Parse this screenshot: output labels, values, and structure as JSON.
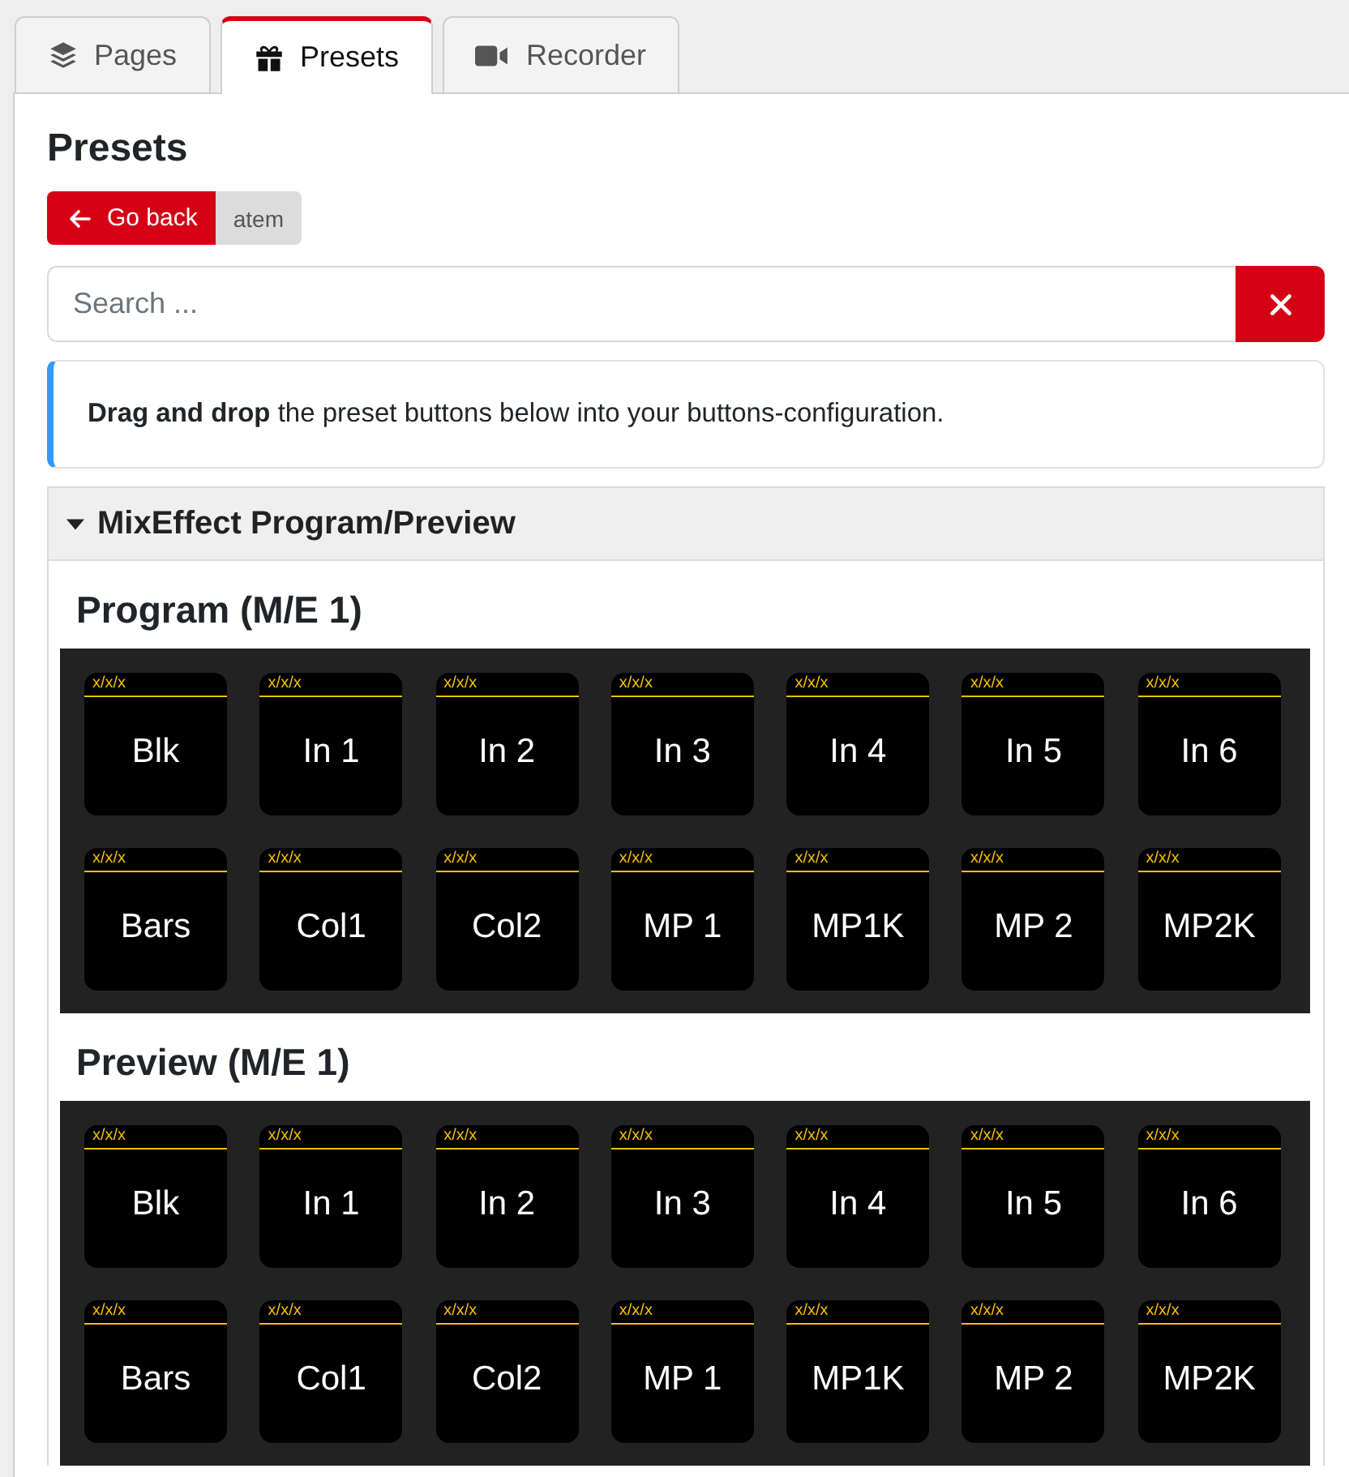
{
  "tabs": [
    {
      "label": "Pages",
      "selected": false
    },
    {
      "label": "Presets",
      "selected": true
    },
    {
      "label": "Recorder",
      "selected": false
    }
  ],
  "page_title": "Presets",
  "breadcrumb": {
    "back_button": "Go back",
    "module": "atem"
  },
  "search": {
    "placeholder": "Search ..."
  },
  "info": "**Drag and drop** the preset buttons below into your buttons-configuration.",
  "accordion": {
    "title": "MixEffect Program/Preview",
    "expanded": true,
    "groups": [
      {
        "heading": "Program (M/E 1)",
        "buttons": [
          {
            "location": "x/x/x",
            "label": "Blk"
          },
          {
            "location": "x/x/x",
            "label": "In 1"
          },
          {
            "location": "x/x/x",
            "label": "In 2"
          },
          {
            "location": "x/x/x",
            "label": "In 3"
          },
          {
            "location": "x/x/x",
            "label": "In 4"
          },
          {
            "location": "x/x/x",
            "label": "In 5"
          },
          {
            "location": "x/x/x",
            "label": "In 6"
          },
          {
            "location": "x/x/x",
            "label": "Bars"
          },
          {
            "location": "x/x/x",
            "label": "Col1"
          },
          {
            "location": "x/x/x",
            "label": "Col2"
          },
          {
            "location": "x/x/x",
            "label": "MP 1"
          },
          {
            "location": "x/x/x",
            "label": "MP1K"
          },
          {
            "location": "x/x/x",
            "label": "MP 2"
          },
          {
            "location": "x/x/x",
            "label": "MP2K"
          }
        ]
      },
      {
        "heading": "Preview (M/E 1)",
        "buttons": [
          {
            "location": "x/x/x",
            "label": "Blk"
          },
          {
            "location": "x/x/x",
            "label": "In 1"
          },
          {
            "location": "x/x/x",
            "label": "In 2"
          },
          {
            "location": "x/x/x",
            "label": "In 3"
          },
          {
            "location": "x/x/x",
            "label": "In 4"
          },
          {
            "location": "x/x/x",
            "label": "In 5"
          },
          {
            "location": "x/x/x",
            "label": "In 6"
          },
          {
            "location": "x/x/x",
            "label": "Bars"
          },
          {
            "location": "x/x/x",
            "label": "Col1"
          },
          {
            "location": "x/x/x",
            "label": "Col2"
          },
          {
            "location": "x/x/x",
            "label": "MP 1"
          },
          {
            "location": "x/x/x",
            "label": "MP1K"
          },
          {
            "location": "x/x/x",
            "label": "MP 2"
          },
          {
            "location": "x/x/x",
            "label": "MP2K"
          }
        ]
      }
    ]
  }
}
